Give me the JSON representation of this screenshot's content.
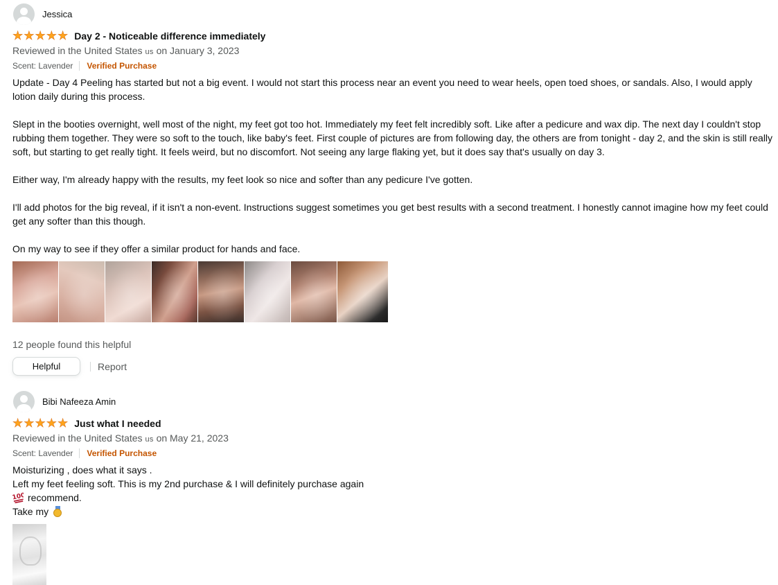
{
  "reviews": [
    {
      "profile_name": "Jessica",
      "rating_stars": 5,
      "title": "Day 2 - Noticeable difference immediately",
      "date_prefix": "Reviewed in the United States",
      "country_code": "us",
      "date_suffix": "on January 3, 2023",
      "scent": "Scent: Lavender",
      "verified": "Verified Purchase",
      "paragraphs": [
        "Update - Day 4 Peeling has started but not a big event. I would not start this process near an event you need to wear heels, open toed shoes, or sandals. Also, I would apply lotion daily during this process.",
        "Slept in the booties overnight, well most of the night, my feet got too hot. Immediately my feet felt incredibly soft. Like after a pedicure and wax dip. The next day I couldn't stop rubbing them together. They were so soft to the touch, like baby's feet. First couple of pictures are from following day, the others are from tonight - day 2, and the skin is still really soft, but starting to get really tight. It feels weird, but no discomfort. Not seeing any large flaking yet, but it does say that's usually on day 3.",
        "Either way, I'm already happy with the results, my feet look so nice and softer than any pedicure I've gotten.",
        "I'll add photos for the big reveal, if it isn't a non-event. Instructions suggest sometimes you get best results with a second treatment. I honestly cannot imagine how my feet could get any softer than this though.",
        "On my way to see if they offer a similar product for hands and face."
      ],
      "image_count": 8,
      "helpful_text": "12 people found this helpful",
      "helpful_button": "Helpful",
      "report_link": "Report"
    },
    {
      "profile_name": "Bibi Nafeeza Amin",
      "rating_stars": 5,
      "title": "Just what I needed",
      "date_prefix": "Reviewed in the United States",
      "country_code": "us",
      "date_suffix": "on May 21, 2023",
      "scent": "Scent: Lavender",
      "verified": "Verified Purchase",
      "lines": [
        "Moisturizing , does what it says .",
        "Left my feet feeling soft. This is my 2nd purchase & I will definitely purchase again",
        "recommend.",
        "Take my"
      ],
      "emoji_icons": [
        "hundred-points-icon",
        "medal-icon"
      ]
    }
  ],
  "colors": {
    "star": "#ffa41c",
    "verified": "#c45500",
    "secondary_text": "#565959",
    "primary_text": "#0f1111"
  }
}
